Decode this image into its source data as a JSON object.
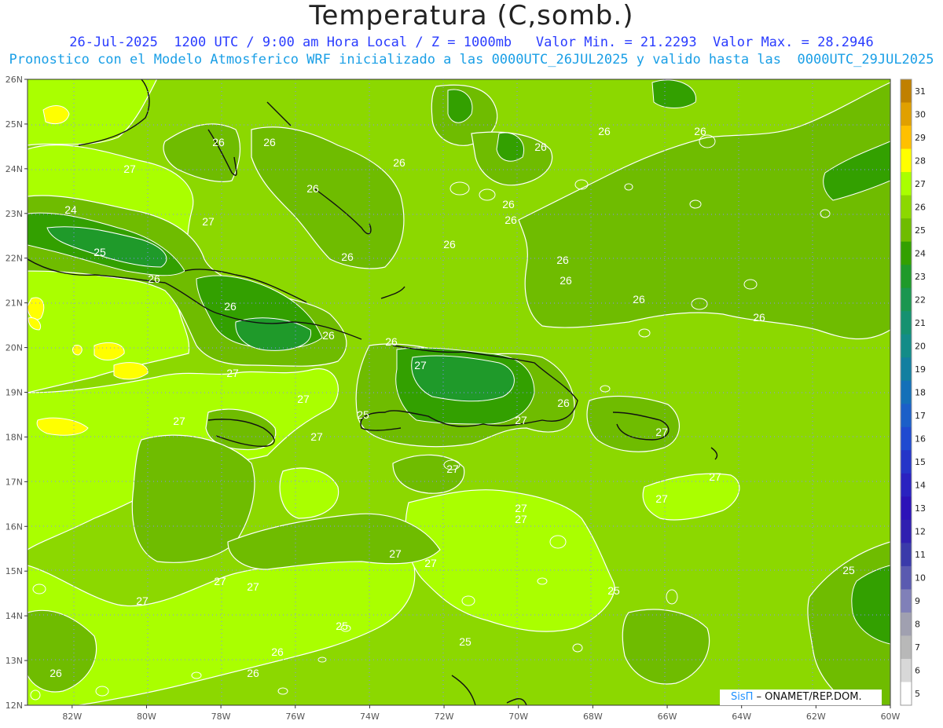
{
  "title": "Temperatura (C,somb.)",
  "subtitle_line1": "26-Jul-2025  1200 UTC / 9:00 am Hora Local / Z = 1000mb   Valor Min. = 21.2293  Valor Max. = 28.2946",
  "subtitle_line2": "Pronostico con el Modelo Atmosferico WRF inicializado a las 0000UTC_26JUL2025 y valido hasta las  0000UTC_29JUL2025",
  "map": {
    "lon_range": [
      -83.2,
      -60
    ],
    "lat_range": [
      12,
      26
    ],
    "x_ticks": [
      "82W",
      "80W",
      "78W",
      "76W",
      "74W",
      "72W",
      "70W",
      "68W",
      "66W",
      "64W",
      "62W",
      "60W"
    ],
    "x_tick_values": [
      -82,
      -80,
      -78,
      -76,
      -74,
      -72,
      -70,
      -68,
      -66,
      -64,
      -62,
      -60
    ],
    "y_ticks": [
      "26N",
      "25N",
      "24N",
      "23N",
      "22N",
      "21N",
      "20N",
      "19N",
      "18N",
      "17N",
      "16N",
      "15N",
      "14N",
      "13N",
      "12N"
    ],
    "y_tick_values": [
      26,
      25,
      24,
      23,
      22,
      21,
      20,
      19,
      18,
      17,
      16,
      15,
      14,
      13,
      12
    ],
    "grid_lines": "dotted",
    "contour_labels": [
      "24",
      "25",
      "26",
      "26",
      "26",
      "26",
      "26",
      "26",
      "26",
      "26",
      "26",
      "26",
      "26",
      "26",
      "26",
      "26",
      "26",
      "26",
      "26",
      "26",
      "26",
      "27",
      "27",
      "27",
      "27",
      "27",
      "27",
      "27",
      "27",
      "27",
      "27",
      "27",
      "27",
      "27",
      "27",
      "27",
      "27",
      "27",
      "25",
      "25",
      "25",
      "26",
      "26",
      "26",
      "26",
      "27",
      "27"
    ]
  },
  "colorbar": {
    "labels": [
      "31",
      "30",
      "29",
      "28",
      "27",
      "26",
      "25",
      "24",
      "23",
      "22",
      "21",
      "20",
      "19",
      "18",
      "17",
      "16",
      "15",
      "14",
      "13",
      "12",
      "11",
      "10",
      "9",
      "8",
      "7",
      "6",
      "5"
    ],
    "colors": [
      "#c08000",
      "#e0a000",
      "#ffc000",
      "#ffff00",
      "#aaff00",
      "#8cd800",
      "#6fbc00",
      "#33a000",
      "#1f9a2a",
      "#1a9650",
      "#159170",
      "#138c88",
      "#127fa0",
      "#1470b8",
      "#1b5fc8",
      "#1f4ad0",
      "#2535c8",
      "#2a22c0",
      "#2c12b8",
      "#3020b0",
      "#3a3aaa",
      "#5a5ab0",
      "#8080b8",
      "#a0a0b0",
      "#b8b8b8",
      "#d8d8d8",
      "#ffffff"
    ]
  },
  "credit": {
    "brand": "SisΠ",
    "text": " – ONAMET/REP.DOM."
  }
}
